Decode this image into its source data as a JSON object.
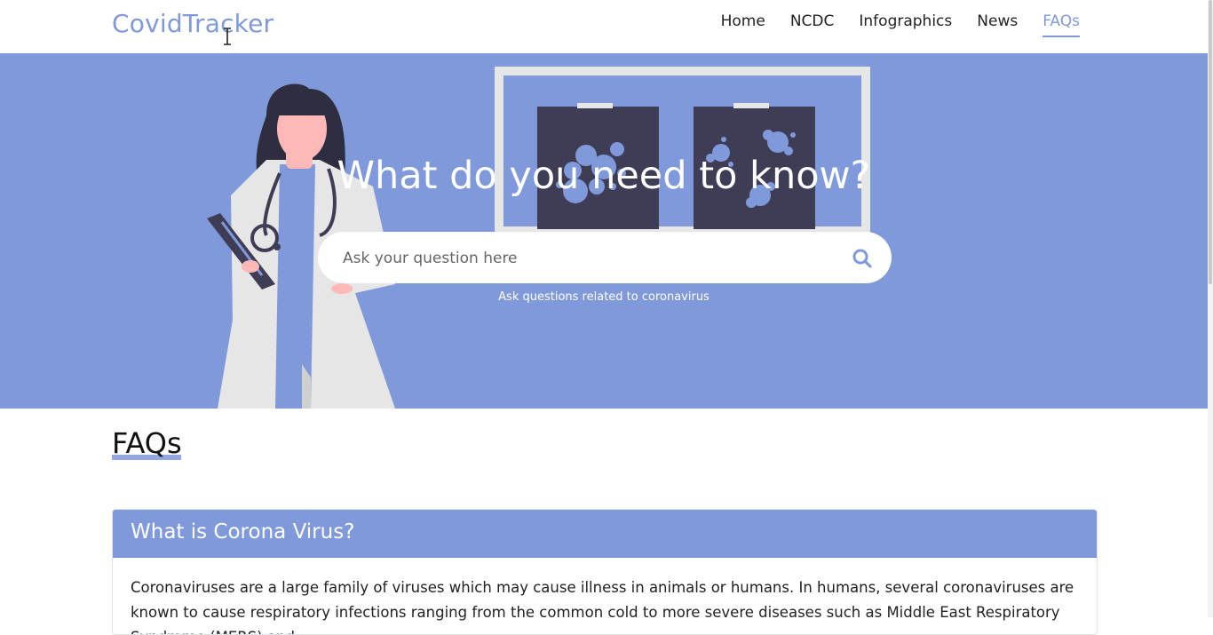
{
  "nav": {
    "brand": "CovidTracker",
    "links": [
      {
        "label": "Home",
        "active": false
      },
      {
        "label": "NCDC",
        "active": false
      },
      {
        "label": "Infographics",
        "active": false
      },
      {
        "label": "News",
        "active": false
      },
      {
        "label": "FAQs",
        "active": true
      }
    ]
  },
  "hero": {
    "title": "What do you need to know?",
    "search_placeholder": "Ask your question here",
    "hint": "Ask questions related to coronavirus"
  },
  "faq": {
    "heading": "FAQs",
    "items": [
      {
        "question": "What is Corona Virus?",
        "answer": "Coronaviruses are a large family of viruses which may cause illness in animals or humans. In humans, several coronaviruses are known to cause respiratory infections ranging from the common cold to more severe diseases such as Middle East Respiratory Syndrome (MERS) and"
      }
    ]
  },
  "icons": {
    "search": "search-icon",
    "cursor": "text-cursor-icon"
  },
  "colors": {
    "accent": "#8099db",
    "hero_bg": "#8099db",
    "xray_dark": "#3f3d56",
    "coat": "#e6e6e6",
    "skin": "#ffb8b8"
  }
}
